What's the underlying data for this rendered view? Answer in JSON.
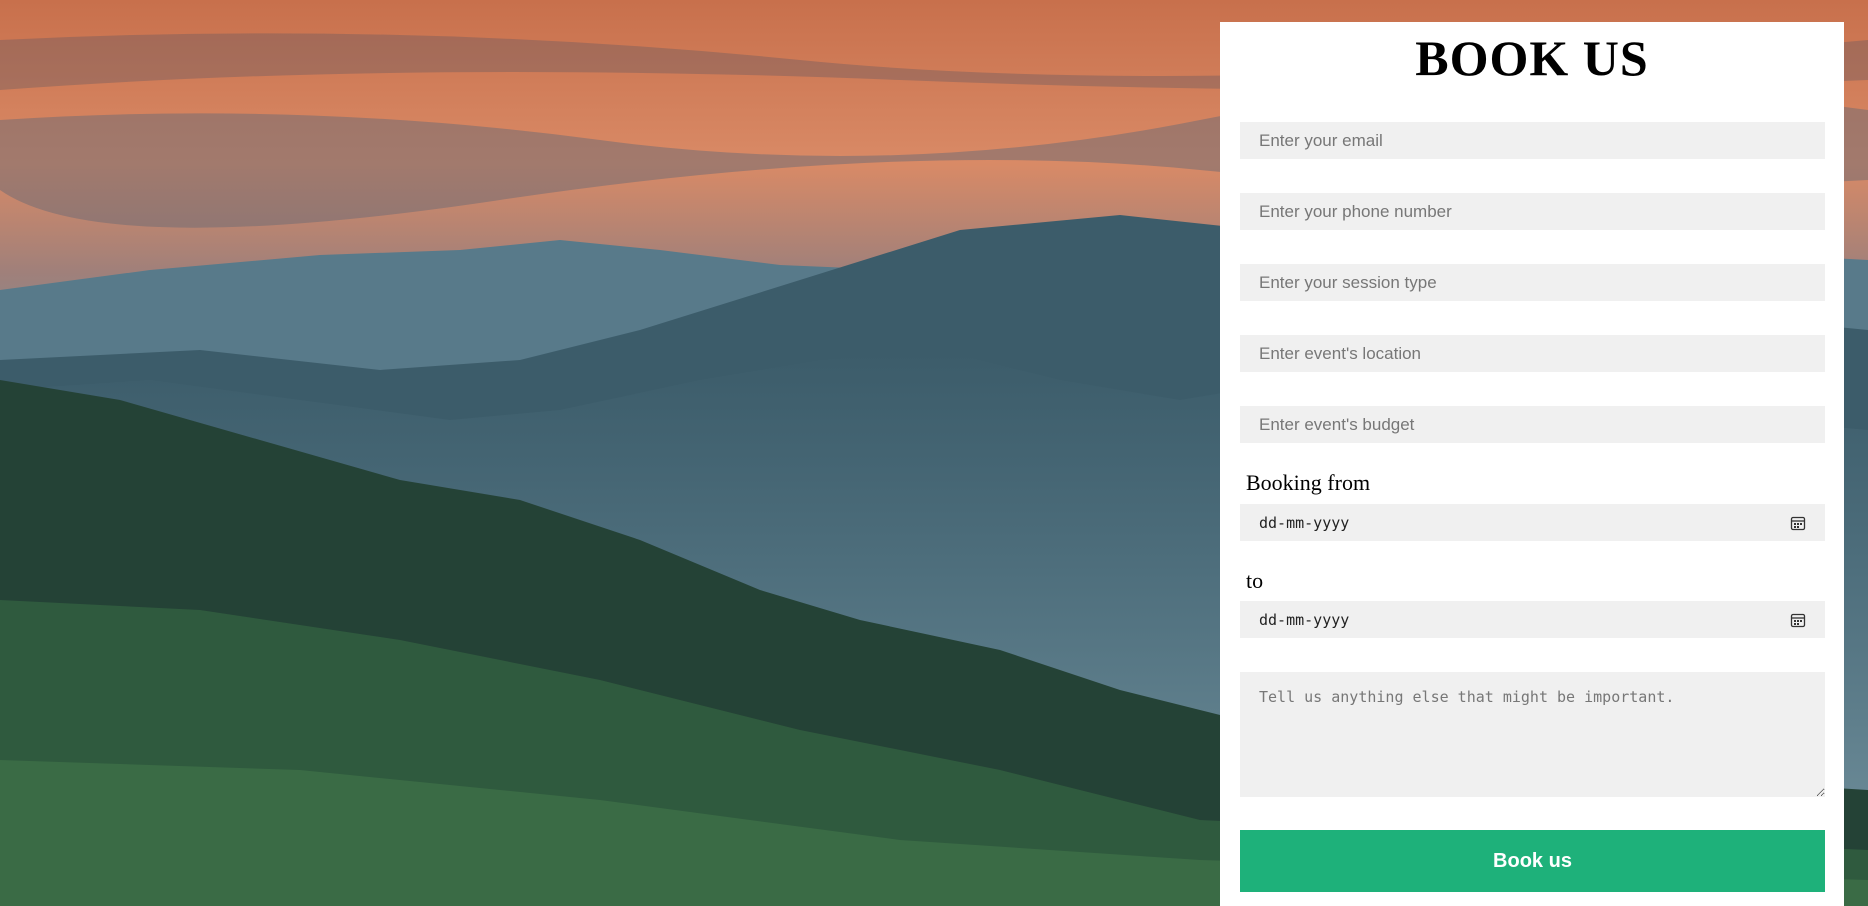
{
  "form": {
    "title": "BOOK US",
    "email_placeholder": "Enter your email",
    "phone_placeholder": "Enter your phone number",
    "session_placeholder": "Enter your session type",
    "location_placeholder": "Enter event's location",
    "budget_placeholder": "Enter event's budget",
    "booking_from_label": "Booking from",
    "booking_from_value": "dd-mm-yyyy",
    "to_label": "to",
    "to_value": "dd-mm-yyyy",
    "notes_placeholder": "Tell us anything else that might be important.",
    "submit_label": "Book us"
  },
  "colors": {
    "button": "#1eb17a",
    "field_background": "#f0f0f0",
    "panel_background": "#ffffff"
  },
  "icons": [
    "calendar-icon"
  ]
}
